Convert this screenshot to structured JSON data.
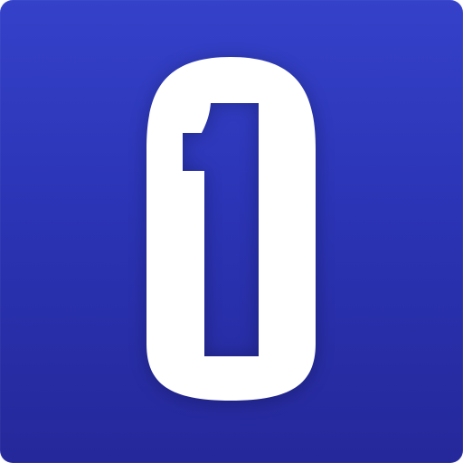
{
  "app_icon": {
    "name": "app icon",
    "logo_glyph": "1",
    "background_gradient": [
      "#3441c9",
      "#2b34b5",
      "#25289a"
    ],
    "logo_color": "#ffffff"
  }
}
